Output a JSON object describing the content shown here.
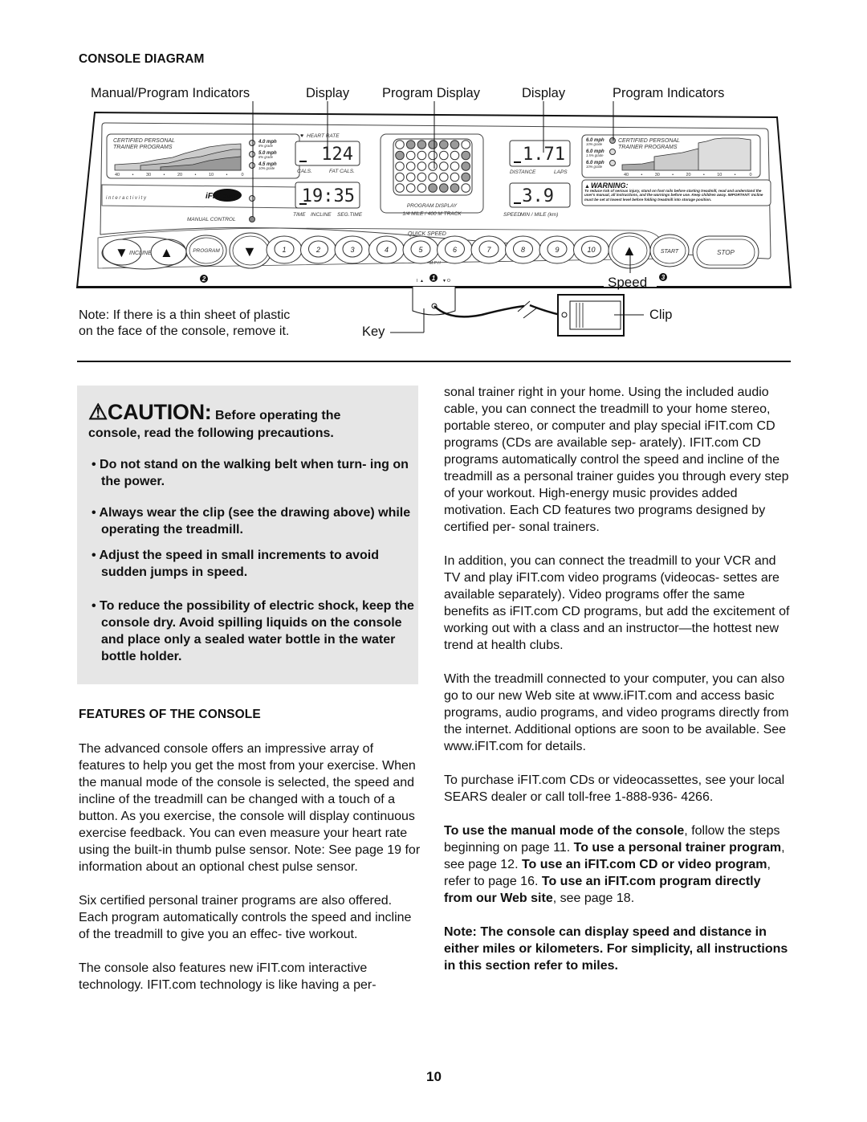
{
  "console_section": {
    "heading": "CONSOLE DIAGRAM",
    "callouts": {
      "manual_program_indicators": "Manual/Program Indicators",
      "display_left": "Display",
      "program_display": "Program Display",
      "display_right": "Display",
      "program_indicators": "Program Indicators",
      "speed": "Speed",
      "clip": "Clip",
      "key": "Key"
    },
    "note": {
      "line1": "Note: If there is a thin sheet of plastic",
      "line2": "on the face of the console, remove it."
    },
    "console": {
      "left_programs_title1": "CERTIFIED PERSONAL",
      "left_programs_title2": "TRAINER PROGRAMS",
      "left_programs": [
        {
          "speed": "4.0 mph",
          "grade": "8% grade"
        },
        {
          "speed": "5.0 mph",
          "grade": "8% grade"
        },
        {
          "speed": "4.5 mph",
          "grade": "10% grade"
        }
      ],
      "scale_ticks": [
        "40",
        "•",
        "30",
        "•",
        "20",
        "•",
        "10",
        "•",
        "0"
      ],
      "interactivity_label": "i n t e r a c t i v i t y",
      "ifit_logo": "iFIT.com",
      "manual_control_label": "MANUAL CONTROL",
      "heart_rate_label": "HEART RATE",
      "display1_value": "124",
      "display1_labels": [
        "CALS.",
        "FAT CALS."
      ],
      "display2_value": "19:35",
      "display2_labels": [
        "TIME",
        "INCLINE",
        "SEG.TIME"
      ],
      "program_display_label": "PROGRAM DISPLAY",
      "track_label": "1/4 MILE / 400 M TRACK",
      "program_matrix": [
        [
          0,
          1,
          1,
          1,
          1,
          1,
          0
        ],
        [
          1,
          0,
          0,
          0,
          0,
          0,
          1
        ],
        [
          0,
          0,
          0,
          0,
          0,
          0,
          1
        ],
        [
          0,
          0,
          0,
          0,
          0,
          0,
          1
        ],
        [
          0,
          0,
          0,
          1,
          1,
          1,
          0
        ]
      ],
      "display3_value": "1.71",
      "display3_labels": [
        "DISTANCE",
        "LAPS"
      ],
      "display4_value": "3.9",
      "display4_labels": [
        "SPEED",
        "MIN / MILE (km)"
      ],
      "right_programs_title1": "CERTIFIED PERSONAL",
      "right_programs_title2": "TRAINER PROGRAMS",
      "right_programs": [
        {
          "speed": "6.0 mph",
          "grade": "10% grade"
        },
        {
          "speed": "6.0 mph",
          "grade": "1.5% grade"
        },
        {
          "speed": "6.0 mph",
          "grade": "10% grade"
        }
      ],
      "warning_title": "WARNING:",
      "warning_text": "To reduce risk of serious injury, stand on foot rails before starting treadmill, read and understand the user's manual, all instructions, and the warnings before use. Keep children away. IMPORTANT: Incline must be set at lowest level before folding treadmill into storage position.",
      "incline_label": "INCLINE",
      "program_button": "PROGRAM",
      "quick_speed_label": "QUICK SPEED",
      "mph_label": "M P H",
      "quick_speeds": [
        "1",
        "2",
        "3",
        "4",
        "5",
        "6",
        "7",
        "8",
        "9",
        "10"
      ],
      "start_button": "START",
      "stop_button": "STOP",
      "marker_1": "1",
      "marker_2": "2",
      "marker_3": "3",
      "key_switch_on": "I",
      "key_switch_off": "O"
    }
  },
  "caution": {
    "title": "CAUTION:",
    "intro_a": "Before operating the",
    "intro_b": "console, read the following precautions.",
    "bullets": [
      "Do not stand on the walking belt when turn- ing on the power.",
      "Always wear the clip (see the drawing above) while operating the treadmill.",
      "Adjust the speed in small increments to avoid sudden jumps in speed.",
      "To reduce the possibility of electric shock, keep the console dry. Avoid spilling liquids on the console and place only a sealed water bottle in the water bottle holder."
    ]
  },
  "features": {
    "heading": "FEATURES OF THE CONSOLE",
    "p1": "The advanced console offers an impressive array of features to help you get the most from your exercise. When the manual mode of the console is selected, the speed and incline of the treadmill can be changed with a touch of a button. As you exercise, the console will display continuous exercise feedback. You can even measure your heart rate using the built-in thumb pulse sensor. Note: See page 19 for information about an optional chest pulse sensor.",
    "p2": "Six certified personal trainer programs are also offered. Each program automatically controls the speed and incline of the treadmill to give you an effec- tive workout.",
    "p3": "The console also features new iFIT.com interactive technology. IFIT.com technology is like having a per-"
  },
  "right_column": {
    "p1": "sonal trainer right in your home. Using the included audio cable, you can connect the treadmill to your home stereo, portable stereo, or computer and play special iFIT.com CD programs (CDs are available sep- arately). IFIT.com CD programs automatically control the speed and incline of the treadmill as a personal trainer guides you through every step of your workout. High-energy music provides added motivation. Each CD features two programs designed by certified per- sonal trainers.",
    "p2": "In addition, you can connect the treadmill to your VCR and TV and play iFIT.com video programs (videocas- settes are available separately). Video programs offer the same benefits as iFIT.com CD programs, but add the excitement of working out with a class and an instructor—the hottest new trend at health clubs.",
    "p3": "With the treadmill connected to your computer, you can also go to our new Web site at www.iFIT.com and access basic programs, audio programs, and video programs directly from the internet. Additional options are soon to be available. See www.iFIT.com for details.",
    "p4": "To purchase iFIT.com CDs or videocassettes, see your local SEARS dealer or call toll-free 1-888-936- 4266.",
    "p5": {
      "b1": "To use the manual mode of the console",
      "t1": ", follow the steps beginning on page 11. ",
      "b2": "To use a personal trainer program",
      "t2": ", see page 12. ",
      "b3": "To use an iFIT.com CD or video program",
      "t3": ", refer to page 16. ",
      "b4": "To use an iFIT.com program directly from our Web site",
      "t4": ", see page 18."
    },
    "p6": "Note: The console can display speed and distance in either miles or kilometers. For simplicity, all instructions in this section refer to miles."
  },
  "page_number": "10"
}
